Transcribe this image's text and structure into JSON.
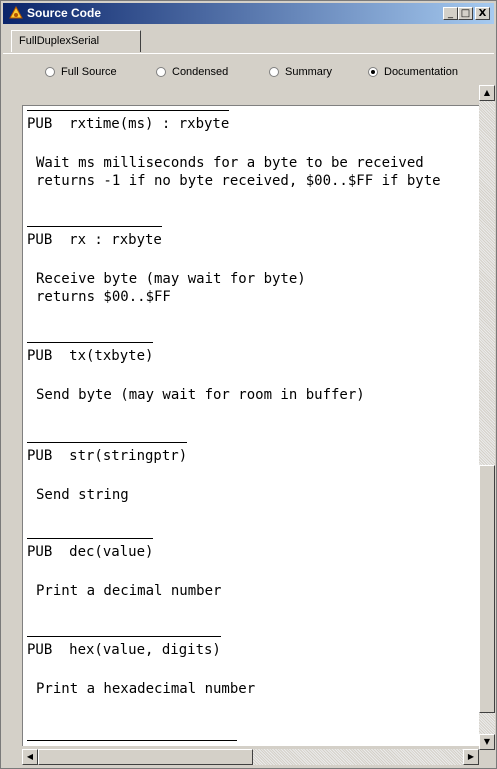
{
  "window": {
    "title": "Source Code",
    "controls": {
      "minimize": "_",
      "maximize": "□",
      "close": "X"
    }
  },
  "tabs": [
    {
      "label": "FullDuplexSerial"
    }
  ],
  "view_options": {
    "items": [
      {
        "label": "Full Source",
        "checked": false
      },
      {
        "label": "Condensed",
        "checked": false
      },
      {
        "label": "Summary",
        "checked": false
      },
      {
        "label": "Documentation",
        "checked": true
      }
    ]
  },
  "methods": [
    {
      "signature": "PUB  rxtime(ms) : rxbyte",
      "description": "Wait ms milliseconds for a byte to be received\nreturns -1 if no byte received, $00..$FF if byte"
    },
    {
      "signature": "PUB  rx : rxbyte",
      "description": "Receive byte (may wait for byte)\nreturns $00..$FF"
    },
    {
      "signature": "PUB  tx(txbyte)",
      "description": "Send byte (may wait for room in buffer)"
    },
    {
      "signature": "PUB  str(stringptr)",
      "description": "Send string"
    },
    {
      "signature": "PUB  dec(value)",
      "description": "Print a decimal number"
    },
    {
      "signature": "PUB  hex(value, digits)",
      "description": "Print a hexadecimal number"
    }
  ],
  "icons": {
    "app": "spin-tool-icon",
    "scroll_up": "arrow-up-icon",
    "scroll_down": "arrow-down-icon",
    "scroll_left": "arrow-left-icon",
    "scroll_right": "arrow-right-icon"
  },
  "colors": {
    "titlebar_start": "#0a246a",
    "titlebar_end": "#a6caf0",
    "face": "#d4d0c8",
    "content_bg": "#ffffff"
  }
}
